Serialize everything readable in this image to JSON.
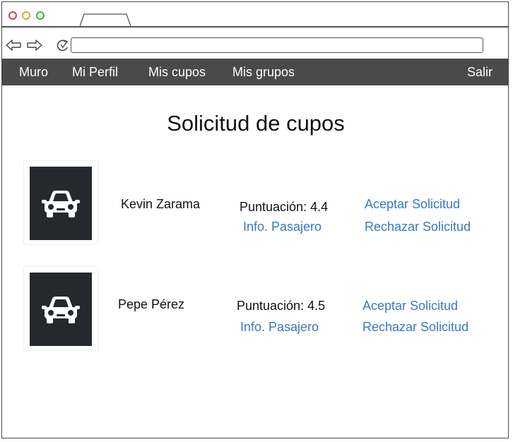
{
  "browser": {
    "url_value": ""
  },
  "navbar": {
    "items": [
      {
        "label": "Muro"
      },
      {
        "label": "Mi Perfil"
      },
      {
        "label": "Mis cupos"
      },
      {
        "label": "Mis grupos"
      }
    ],
    "logout_label": "Salir"
  },
  "page": {
    "title": "Solicitud de cupos"
  },
  "requests": [
    {
      "name": "Kevin Zarama",
      "score_label": "Puntuación:",
      "score": "4.4",
      "info_label": "Info. Pasajero",
      "accept_label": "Aceptar Solicitud",
      "reject_label": "Rechazar Solicitud",
      "avatar_icon": "car-icon"
    },
    {
      "name": "Pepe Pérez",
      "score_label": "Puntuación:",
      "score": "4.5",
      "info_label": "Info. Pasajero",
      "accept_label": "Aceptar Solicitud",
      "reject_label": "Rechazar Solicitud",
      "avatar_icon": "car-icon"
    }
  ],
  "colors": {
    "navbar_bg": "#4a4a4a",
    "link": "#3a78c0",
    "avatar_bg": "#25292d"
  }
}
